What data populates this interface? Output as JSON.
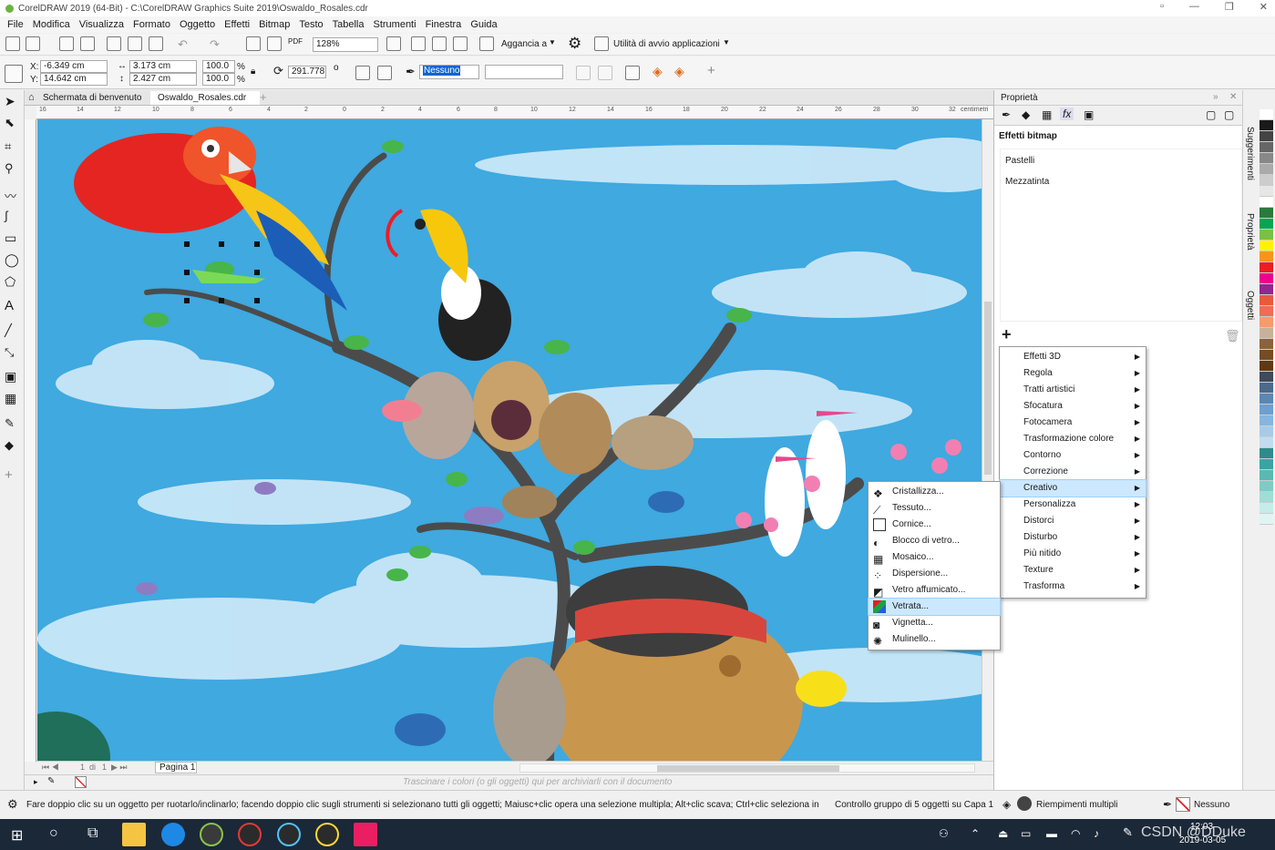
{
  "window": {
    "title": "CorelDRAW 2019 (64-Bit) - C:\\CorelDRAW Graphics Suite 2019\\Oswaldo_Rosales.cdr"
  },
  "menu": [
    "File",
    "Modifica",
    "Visualizza",
    "Formato",
    "Oggetto",
    "Effetti",
    "Bitmap",
    "Testo",
    "Tabella",
    "Strumenti",
    "Finestra",
    "Guida"
  ],
  "toolbar1": {
    "zoom": "128%",
    "snap_label": "Aggancia a",
    "launcher_label": "Utilità di avvio applicazioni"
  },
  "toolbar2": {
    "x": "-6.349 cm",
    "y": "14.642 cm",
    "w": "3.173 cm",
    "h": "2.427 cm",
    "sx": "100.0",
    "sy": "100.0",
    "pct": "%",
    "angle": "291.778",
    "angle_unit": "o",
    "outline": "Nessuno"
  },
  "doc_tabs": [
    "Schermata di benvenuto",
    "Oswaldo_Rosales.cdr"
  ],
  "ruler": {
    "unit": "centimetri",
    "h_ticks": [
      "16",
      "14",
      "12",
      "10",
      "8",
      "6",
      "4",
      "2",
      "0",
      "2",
      "4",
      "6",
      "8",
      "10",
      "12",
      "14",
      "16",
      "18",
      "20",
      "22",
      "24",
      "26",
      "28",
      "30",
      "32"
    ]
  },
  "page_nav": {
    "current": "1",
    "of": "di",
    "total": "1",
    "page_label": "Pagina 1"
  },
  "palette_hint": "Trascinare i colori (o gli oggetti) qui per archiviarli con il documento",
  "docker": {
    "title": "Proprietà",
    "section": "Effetti bitmap",
    "applied_effects": [
      "Pastelli",
      "Mezzatinta"
    ]
  },
  "side_tabs": [
    "Suggerimenti",
    "Proprietà",
    "Oggetti"
  ],
  "effects_menu": [
    {
      "label": "Effetti 3D"
    },
    {
      "label": "Regola"
    },
    {
      "label": "Tratti artistici"
    },
    {
      "label": "Sfocatura"
    },
    {
      "label": "Fotocamera"
    },
    {
      "label": "Trasformazione colore"
    },
    {
      "label": "Contorno"
    },
    {
      "label": "Correzione"
    },
    {
      "label": "Creativo",
      "selected": true
    },
    {
      "label": "Personalizza"
    },
    {
      "label": "Distorci"
    },
    {
      "label": "Disturbo"
    },
    {
      "label": "Più nitido"
    },
    {
      "label": "Texture"
    },
    {
      "label": "Trasforma"
    }
  ],
  "creative_submenu": [
    {
      "label": "Cristallizza..."
    },
    {
      "label": "Tessuto..."
    },
    {
      "label": "Cornice..."
    },
    {
      "label": "Blocco di vetro..."
    },
    {
      "label": "Mosaico..."
    },
    {
      "label": "Dispersione..."
    },
    {
      "label": "Vetro affumicato..."
    },
    {
      "label": "Vetrata...",
      "selected": true
    },
    {
      "label": "Vignetta..."
    },
    {
      "label": "Mulinello..."
    }
  ],
  "status": {
    "hint": "Fare doppio clic su un oggetto per ruotarlo/inclinarlo; facendo doppio clic sugli strumenti si selezionano tutti gli oggetti; Maiusc+clic opera una selezione multipla; Alt+clic scava; Ctrl+clic seleziona in un gruppo",
    "selection": "Controllo gruppo di 5 oggetti su Capa 1",
    "fill": "Riempimenti multipli",
    "outline": "Nessuno"
  },
  "taskbar": {
    "time": "12:03",
    "date": "2019-03-05",
    "watermark": "CSDN @DDuke"
  },
  "palette_colors": [
    "#ffffff",
    "#1a1a1a",
    "#444444",
    "#666666",
    "#888888",
    "#aaaaaa",
    "#cccccc",
    "#e6e6e6",
    "#ffffff",
    "#2b7a3d",
    "#00a651",
    "#7ac143",
    "#fff200",
    "#f7941d",
    "#ed1c24",
    "#ec008c",
    "#92278f",
    "#e85a3c",
    "#f26c4f",
    "#f79a6c",
    "#c7b299",
    "#8c6239",
    "#754c24",
    "#603913",
    "#3f4a5a",
    "#4a6b8a",
    "#5b87b0",
    "#6d9fcf",
    "#86b5de",
    "#a6cbe8",
    "#c1dcf0",
    "#2e8b8b",
    "#3aa3a3",
    "#5cb8b2",
    "#7fcbc4",
    "#a2dcd6",
    "#c5ece8",
    "#e0f5f3"
  ],
  "colors": {
    "sky": "#3fa9e0",
    "menu_highlight": "#cce8ff",
    "taskbar": "#1b2838"
  }
}
